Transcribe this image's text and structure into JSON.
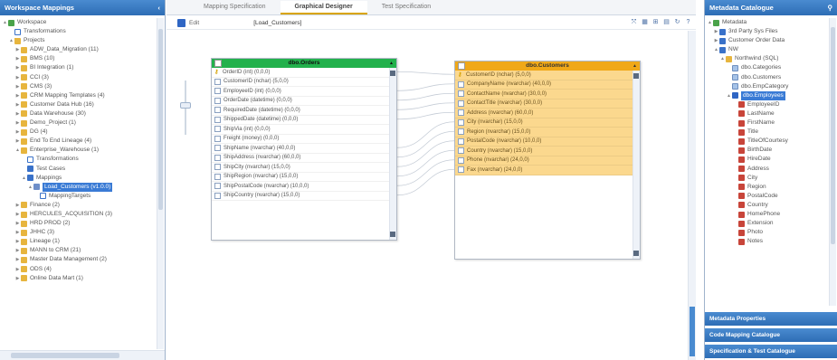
{
  "left_panel": {
    "title": "Workspace Mappings",
    "tree": [
      {
        "depth": 0,
        "tog": "▲",
        "icon": "green",
        "label": "Workspace",
        "icon_name": "workspace-icon"
      },
      {
        "depth": 1,
        "tog": "",
        "icon": "doc",
        "label": "Transformations",
        "icon_name": "transformation-icon"
      },
      {
        "depth": 1,
        "tog": "▲",
        "icon": "folder",
        "label": "Projects",
        "icon_name": "folder-icon"
      },
      {
        "depth": 2,
        "tog": "▶",
        "icon": "project",
        "label": "ADW_Data_Migration (11)",
        "icon_name": "project-icon"
      },
      {
        "depth": 2,
        "tog": "▶",
        "icon": "project",
        "label": "BMS (10)",
        "icon_name": "project-icon"
      },
      {
        "depth": 2,
        "tog": "▶",
        "icon": "project",
        "label": "BI Integration (1)",
        "icon_name": "project-icon"
      },
      {
        "depth": 2,
        "tog": "▶",
        "icon": "project",
        "label": "CCI (3)",
        "icon_name": "project-icon"
      },
      {
        "depth": 2,
        "tog": "▶",
        "icon": "project",
        "label": "CMS (3)",
        "icon_name": "project-icon"
      },
      {
        "depth": 2,
        "tog": "▶",
        "icon": "project",
        "label": "CRM Mapping Templates (4)",
        "icon_name": "project-icon"
      },
      {
        "depth": 2,
        "tog": "▶",
        "icon": "project",
        "label": "Customer Data Hub (16)",
        "icon_name": "project-icon"
      },
      {
        "depth": 2,
        "tog": "▶",
        "icon": "project",
        "label": "Data Warehouse (30)",
        "icon_name": "project-icon"
      },
      {
        "depth": 2,
        "tog": "▶",
        "icon": "project",
        "label": "Demo_Project (1)",
        "icon_name": "project-icon"
      },
      {
        "depth": 2,
        "tog": "▶",
        "icon": "project",
        "label": "DG (4)",
        "icon_name": "project-icon"
      },
      {
        "depth": 2,
        "tog": "▶",
        "icon": "project",
        "label": "End To End Lineage (4)",
        "icon_name": "project-icon"
      },
      {
        "depth": 2,
        "tog": "▲",
        "icon": "project",
        "label": "Enterprise_Warehouse (1)",
        "icon_name": "project-icon"
      },
      {
        "depth": 3,
        "tog": "",
        "icon": "doc",
        "label": "Transformations",
        "icon_name": "transformation-icon"
      },
      {
        "depth": 3,
        "tog": "",
        "icon": "blue",
        "label": "Test Cases",
        "icon_name": "test-case-icon"
      },
      {
        "depth": 3,
        "tog": "▲",
        "icon": "blue",
        "label": "Mappings",
        "icon_name": "mapping-folder-icon"
      },
      {
        "depth": 4,
        "tog": "▲",
        "icon": "map",
        "label": "Load_Customers (v1.0.0)",
        "icon_name": "mapping-icon",
        "selected": true
      },
      {
        "depth": 5,
        "tog": "",
        "icon": "doc",
        "label": "MappingTargets",
        "icon_name": "mapping-targets-icon"
      },
      {
        "depth": 2,
        "tog": "▶",
        "icon": "project",
        "label": "Finance (2)",
        "icon_name": "project-icon"
      },
      {
        "depth": 2,
        "tog": "▶",
        "icon": "project",
        "label": "HERCULES_ACQUISITION (3)",
        "icon_name": "project-icon"
      },
      {
        "depth": 2,
        "tog": "▶",
        "icon": "project",
        "label": "HRD PROD (2)",
        "icon_name": "project-icon"
      },
      {
        "depth": 2,
        "tog": "▶",
        "icon": "project",
        "label": "JHHC (3)",
        "icon_name": "project-icon"
      },
      {
        "depth": 2,
        "tog": "▶",
        "icon": "project",
        "label": "Lineage (1)",
        "icon_name": "project-icon"
      },
      {
        "depth": 2,
        "tog": "▶",
        "icon": "project",
        "label": "MANN to CRM (21)",
        "icon_name": "project-icon"
      },
      {
        "depth": 2,
        "tog": "▶",
        "icon": "project",
        "label": "Master Data Management (2)",
        "icon_name": "project-icon"
      },
      {
        "depth": 2,
        "tog": "▶",
        "icon": "project",
        "label": "ODS (4)",
        "icon_name": "project-icon"
      },
      {
        "depth": 2,
        "tog": "▶",
        "icon": "project",
        "label": "Online Data Mart (1)",
        "icon_name": "project-icon"
      }
    ]
  },
  "center": {
    "tabs": [
      {
        "label": "Mapping Specification",
        "active": false
      },
      {
        "label": "Graphical Designer",
        "active": true
      },
      {
        "label": "Test Specification",
        "active": false
      }
    ],
    "toolbar": {
      "left_text": "Edit",
      "title": "[Load_Customers]"
    },
    "toolbar_icons": [
      "expand-icon",
      "layout-icon",
      "fit-icon",
      "export-icon",
      "refresh-icon",
      "help-icon"
    ],
    "toolbar_glyphs": [
      "⤧",
      "▦",
      "⊞",
      "▤",
      "↻",
      "?"
    ],
    "orders": {
      "title": "dbo.Orders",
      "rows": [
        {
          "key": true,
          "label": "OrderID (int) (0,0,0)"
        },
        {
          "key": false,
          "label": "CustomerID (nchar) (5,0,0)"
        },
        {
          "key": false,
          "label": "EmployeeID (int) (0,0,0)"
        },
        {
          "key": false,
          "label": "OrderDate (datetime) (0,0,0)"
        },
        {
          "key": false,
          "label": "RequiredDate (datetime) (0,0,0)"
        },
        {
          "key": false,
          "label": "ShippedDate (datetime) (0,0,0)"
        },
        {
          "key": false,
          "label": "ShipVia (int) (0,0,0)"
        },
        {
          "key": false,
          "label": "Freight (money) (0,0,0)"
        },
        {
          "key": false,
          "label": "ShipName (nvarchar) (40,0,0)"
        },
        {
          "key": false,
          "label": "ShipAddress (nvarchar) (60,0,0)"
        },
        {
          "key": false,
          "label": "ShipCity (nvarchar) (15,0,0)"
        },
        {
          "key": false,
          "label": "ShipRegion (nvarchar) (15,0,0)"
        },
        {
          "key": false,
          "label": "ShipPostalCode (nvarchar) (10,0,0)"
        },
        {
          "key": false,
          "label": "ShipCountry (nvarchar) (15,0,0)"
        }
      ]
    },
    "customers": {
      "title": "dbo.Customers",
      "rows": [
        {
          "key": true,
          "label": "CustomerID (nchar) (5,0,0)"
        },
        {
          "key": false,
          "label": "CompanyName (nvarchar) (40,0,0)"
        },
        {
          "key": false,
          "label": "ContactName (nvarchar) (30,0,0)"
        },
        {
          "key": false,
          "label": "ContactTitle (nvarchar) (30,0,0)"
        },
        {
          "key": false,
          "label": "Address (nvarchar) (60,0,0)"
        },
        {
          "key": false,
          "label": "City (nvarchar) (15,0,0)"
        },
        {
          "key": false,
          "label": "Region (nvarchar) (15,0,0)"
        },
        {
          "key": false,
          "label": "PostalCode (nvarchar) (10,0,0)"
        },
        {
          "key": false,
          "label": "Country (nvarchar) (15,0,0)"
        },
        {
          "key": false,
          "label": "Phone (nvarchar) (24,0,0)"
        },
        {
          "key": false,
          "label": "Fax (nvarchar) (24,0,0)"
        }
      ]
    }
  },
  "right_panel": {
    "title": "Metadata Catalogue",
    "tree": [
      {
        "depth": 0,
        "tog": "▲",
        "icon": "green",
        "label": "Metadata",
        "icon_name": "metadata-icon"
      },
      {
        "depth": 1,
        "tog": "▶",
        "icon": "blue",
        "label": "3rd Party Sys Files",
        "icon_name": "system-icon"
      },
      {
        "depth": 1,
        "tog": "▶",
        "icon": "blue",
        "label": "Customer Order Data",
        "icon_name": "system-icon"
      },
      {
        "depth": 1,
        "tog": "▲",
        "icon": "blue",
        "label": "NW",
        "icon_name": "system-icon"
      },
      {
        "depth": 2,
        "tog": "▲",
        "icon": "project",
        "label": "Northwind (SQL)",
        "icon_name": "database-icon"
      },
      {
        "depth": 3,
        "tog": "",
        "icon": "sheet",
        "label": "dbo.Categories",
        "icon_name": "table-icon"
      },
      {
        "depth": 3,
        "tog": "",
        "icon": "sheet",
        "label": "dbo.Customers",
        "icon_name": "table-icon"
      },
      {
        "depth": 3,
        "tog": "",
        "icon": "sheet",
        "label": "dbo.EmpCategory",
        "icon_name": "table-icon"
      },
      {
        "depth": 3,
        "tog": "▲",
        "icon": "table",
        "label": "dbo.Employees",
        "icon_name": "table-icon",
        "selected": true
      },
      {
        "depth": 4,
        "tog": "",
        "icon": "col",
        "label": "EmployeeID",
        "icon_name": "column-icon"
      },
      {
        "depth": 4,
        "tog": "",
        "icon": "col",
        "label": "LastName",
        "icon_name": "column-icon"
      },
      {
        "depth": 4,
        "tog": "",
        "icon": "col",
        "label": "FirstName",
        "icon_name": "column-icon"
      },
      {
        "depth": 4,
        "tog": "",
        "icon": "col",
        "label": "Title",
        "icon_name": "column-icon"
      },
      {
        "depth": 4,
        "tog": "",
        "icon": "col",
        "label": "TitleOfCourtesy",
        "icon_name": "column-icon"
      },
      {
        "depth": 4,
        "tog": "",
        "icon": "col",
        "label": "BirthDate",
        "icon_name": "column-icon"
      },
      {
        "depth": 4,
        "tog": "",
        "icon": "col",
        "label": "HireDate",
        "icon_name": "column-icon"
      },
      {
        "depth": 4,
        "tog": "",
        "icon": "col",
        "label": "Address",
        "icon_name": "column-icon"
      },
      {
        "depth": 4,
        "tog": "",
        "icon": "col",
        "label": "City",
        "icon_name": "column-icon"
      },
      {
        "depth": 4,
        "tog": "",
        "icon": "col",
        "label": "Region",
        "icon_name": "column-icon"
      },
      {
        "depth": 4,
        "tog": "",
        "icon": "col",
        "label": "PostalCode",
        "icon_name": "column-icon"
      },
      {
        "depth": 4,
        "tog": "",
        "icon": "col",
        "label": "Country",
        "icon_name": "column-icon"
      },
      {
        "depth": 4,
        "tog": "",
        "icon": "col",
        "label": "HomePhone",
        "icon_name": "column-icon"
      },
      {
        "depth": 4,
        "tog": "",
        "icon": "col",
        "label": "Extension",
        "icon_name": "column-icon"
      },
      {
        "depth": 4,
        "tog": "",
        "icon": "col",
        "label": "Photo",
        "icon_name": "column-icon"
      },
      {
        "depth": 4,
        "tog": "",
        "icon": "col",
        "label": "Notes",
        "icon_name": "column-icon"
      }
    ],
    "accordion": [
      "Metadata Properties",
      "Code Mapping Catalogue",
      "Specification & Test Catalogue"
    ]
  },
  "colors": {
    "accent": "#2d6db5",
    "source_header": "#22b14c",
    "target_header": "#f0a818",
    "target_row": "#fbd88e",
    "active_tab": "#d9a400"
  }
}
